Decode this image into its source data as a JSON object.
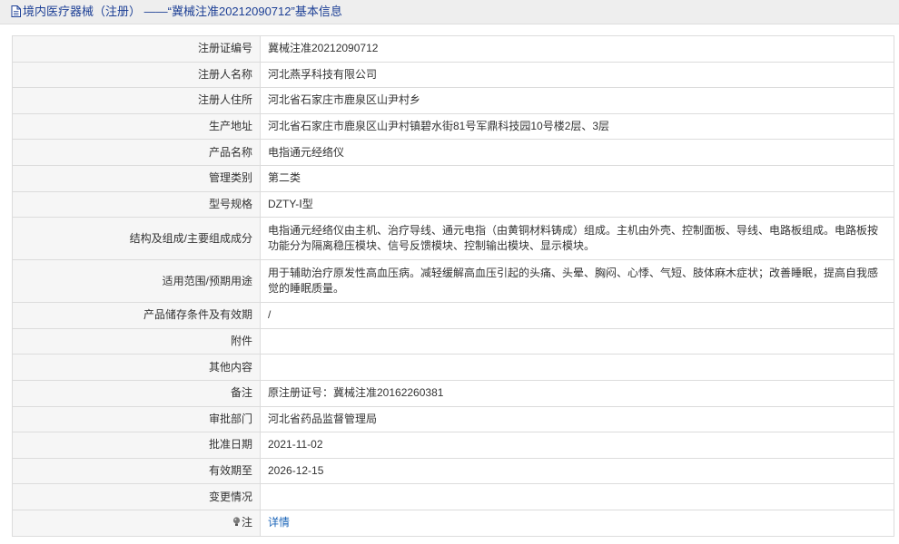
{
  "header": {
    "icon": "document-icon",
    "category": "境内医疗器械（注册）",
    "separator": "——",
    "subject": "“冀械注准20212090712”基本信息"
  },
  "rows": [
    {
      "label": "注册证编号",
      "value": "冀械注准20212090712"
    },
    {
      "label": "注册人名称",
      "value": "河北燕孚科技有限公司"
    },
    {
      "label": "注册人住所",
      "value": "河北省石家庄市鹿泉区山尹村乡"
    },
    {
      "label": "生产地址",
      "value": "河北省石家庄市鹿泉区山尹村镇碧水街81号军鼎科技园10号楼2层、3层"
    },
    {
      "label": "产品名称",
      "value": "电指通元经络仪"
    },
    {
      "label": "管理类别",
      "value": "第二类"
    },
    {
      "label": "型号规格",
      "value": "DZTY-Ⅰ型"
    },
    {
      "label": "结构及组成/主要组成成分",
      "value": "电指通元经络仪由主机、治疗导线、通元电指（由黄铜材料铸成）组成。主机由外壳、控制面板、导线、电路板组成。电路板按功能分为隔离稳压模块、信号反馈模块、控制输出模块、显示模块。"
    },
    {
      "label": "适用范围/预期用途",
      "value": "用于辅助治疗原发性高血压病。减轻缓解高血压引起的头痛、头晕、胸闷、心悸、气短、肢体麻木症状；改善睡眠，提高自我感觉的睡眠质量。"
    },
    {
      "label": "产品储存条件及有效期",
      "value": "/"
    },
    {
      "label": "附件",
      "value": ""
    },
    {
      "label": "其他内容",
      "value": ""
    },
    {
      "label": "备注",
      "value": "原注册证号：冀械注准20162260381"
    },
    {
      "label": "审批部门",
      "value": "河北省药品监督管理局"
    },
    {
      "label": "批准日期",
      "value": "2021-11-02"
    },
    {
      "label": "有效期至",
      "value": "2026-12-15"
    },
    {
      "label": "变更情况",
      "value": ""
    }
  ],
  "note": {
    "icon": "lightbulb-icon",
    "label": "注",
    "link": "详情"
  }
}
